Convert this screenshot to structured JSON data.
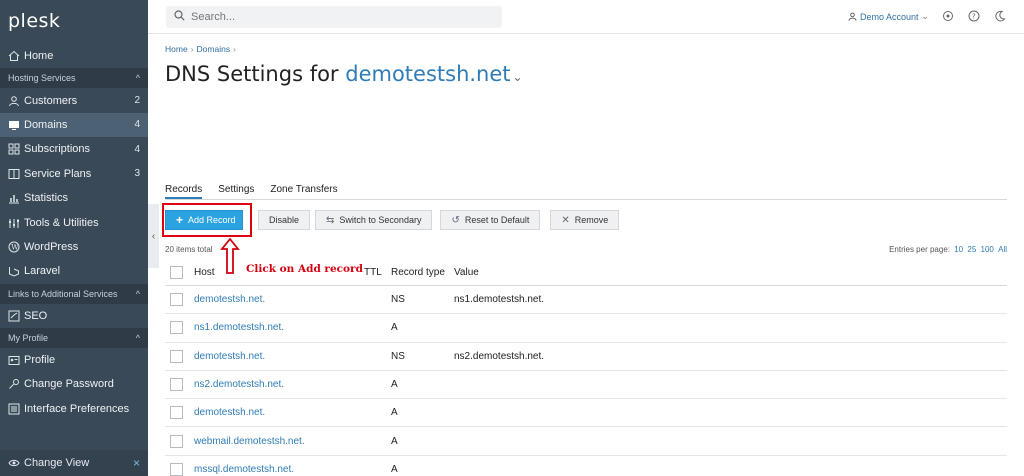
{
  "brand": {
    "logo_text": "plesk"
  },
  "sidebar": {
    "home": "Home",
    "sections": [
      {
        "label": "Hosting Services",
        "items": [
          {
            "label": "Customers",
            "count": "2",
            "icon": "person-icon"
          },
          {
            "label": "Domains",
            "count": "4",
            "icon": "monitor-icon",
            "active": true
          },
          {
            "label": "Subscriptions",
            "count": "4",
            "icon": "grid-icon"
          },
          {
            "label": "Service Plans",
            "count": "3",
            "icon": "book-icon"
          },
          {
            "label": "Statistics",
            "icon": "chart-icon"
          },
          {
            "label": "Tools & Utilities",
            "icon": "tools-icon"
          },
          {
            "label": "WordPress",
            "icon": "wordpress-icon"
          },
          {
            "label": "Laravel",
            "icon": "laravel-icon"
          }
        ]
      },
      {
        "label": "Links to Additional Services",
        "items": [
          {
            "label": "SEO",
            "icon": "seo-icon"
          }
        ]
      },
      {
        "label": "My Profile",
        "items": [
          {
            "label": "Profile",
            "icon": "id-card-icon"
          },
          {
            "label": "Change Password",
            "icon": "key-icon"
          },
          {
            "label": "Interface Preferences",
            "icon": "list-icon"
          }
        ]
      }
    ],
    "footer": {
      "label": "Change View",
      "close": "×"
    }
  },
  "topbar": {
    "search_placeholder": "Search...",
    "account": "Demo Account"
  },
  "breadcrumb": [
    "Home",
    "Domains"
  ],
  "title": {
    "prefix": "DNS Settings for ",
    "domain": "demotestsh.net"
  },
  "tabs": [
    "Records",
    "Settings",
    "Zone Transfers"
  ],
  "toolbar": {
    "add_record": "Add Record",
    "disable": "Disable",
    "switch_secondary": "Switch to Secondary",
    "reset_default": "Reset to Default",
    "remove": "Remove"
  },
  "items_total": "20 items total",
  "per_page": {
    "label": "Entries per page:",
    "options": [
      "10",
      "25",
      "100",
      "All"
    ]
  },
  "annotation": "Click on Add record",
  "table": {
    "columns": {
      "host": "Host",
      "ttl": "TTL",
      "type": "Record type",
      "value": "Value"
    },
    "rows": [
      {
        "host": "demotestsh.net.",
        "ttl": "",
        "type": "NS",
        "value": "ns1.demotestsh.net."
      },
      {
        "host": "ns1.demotestsh.net.",
        "ttl": "",
        "type": "A",
        "value": ""
      },
      {
        "host": "demotestsh.net.",
        "ttl": "",
        "type": "NS",
        "value": "ns2.demotestsh.net."
      },
      {
        "host": "ns2.demotestsh.net.",
        "ttl": "",
        "type": "A",
        "value": ""
      },
      {
        "host": "demotestsh.net.",
        "ttl": "",
        "type": "A",
        "value": ""
      },
      {
        "host": "webmail.demotestsh.net.",
        "ttl": "",
        "type": "A",
        "value": ""
      },
      {
        "host": "mssql.demotestsh.net.",
        "ttl": "",
        "type": "A",
        "value": ""
      }
    ]
  },
  "colors": {
    "sidebar": "#3a4957",
    "accent": "#2aa3e0",
    "link": "#2f7cb6",
    "highlight": "#e1000f"
  }
}
